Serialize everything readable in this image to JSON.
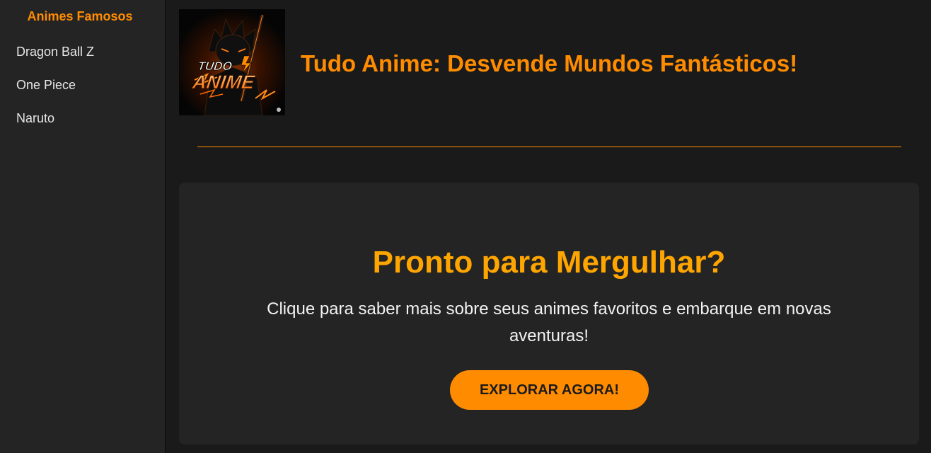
{
  "sidebar": {
    "title": "Animes Famosos",
    "items": [
      {
        "label": "Dragon Ball Z"
      },
      {
        "label": "One Piece"
      },
      {
        "label": "Naruto"
      }
    ]
  },
  "header": {
    "logo_icon": "tudo-anime-logo",
    "title": "Tudo Anime: Desvende Mundos Fantásticos!"
  },
  "cta": {
    "title": "Pronto para Mergulhar?",
    "text": "Clique para saber mais sobre seus animes favoritos e embarque em novas aventuras!",
    "button_label": "EXPLORAR AGORA!"
  },
  "colors": {
    "accent": "#ff8c00",
    "heading": "#ffa500",
    "background": "#1a1a1a",
    "panel": "#242424"
  }
}
